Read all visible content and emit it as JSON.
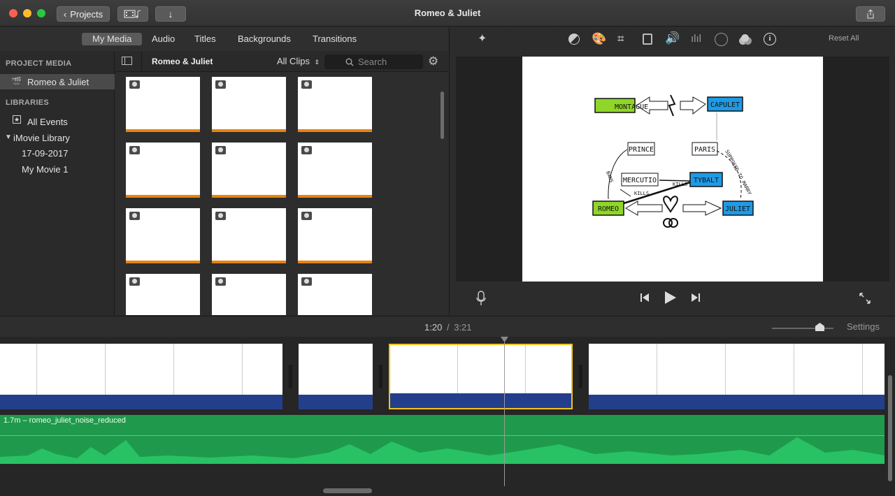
{
  "window": {
    "title": "Romeo & Juliet"
  },
  "toolbar": {
    "projects_label": "Projects",
    "reset_all": "Reset All"
  },
  "tabs": [
    "My Media",
    "Audio",
    "Titles",
    "Backgrounds",
    "Transitions"
  ],
  "sidebar": {
    "project_media_heading": "PROJECT MEDIA",
    "project_item": "Romeo & Juliet",
    "libraries_heading": "LIBRARIES",
    "all_events": "All Events",
    "library": "iMovie Library",
    "event_date": "17-09-2017",
    "movie": "My Movie 1"
  },
  "browser": {
    "title": "Romeo & Juliet",
    "filter": "All Clips",
    "search_placeholder": "Search"
  },
  "timeline": {
    "current_time": "1:20",
    "separator": "/",
    "total_time": "3:21",
    "settings_label": "Settings",
    "audio_clip": "1.7m – romeo_juliet_noise_reduced"
  },
  "diagram": {
    "montague": "MONTAGUE",
    "capulet": "CAPULET",
    "prince": "PRINCE",
    "paris": "PARIS",
    "mercutio": "MERCUTIO",
    "tybalt": "TYBALT",
    "romeo": "ROMEO",
    "juliet": "JULIET",
    "bans": "BANS",
    "kills1": "KILLS",
    "kills2": "KILLS",
    "supposed": "SUPPOSED TO MARRY"
  },
  "colors": {
    "green": "#8fd628",
    "blue": "#1e9be6",
    "orange": "#e8830f",
    "selection": "#f3c21b"
  }
}
